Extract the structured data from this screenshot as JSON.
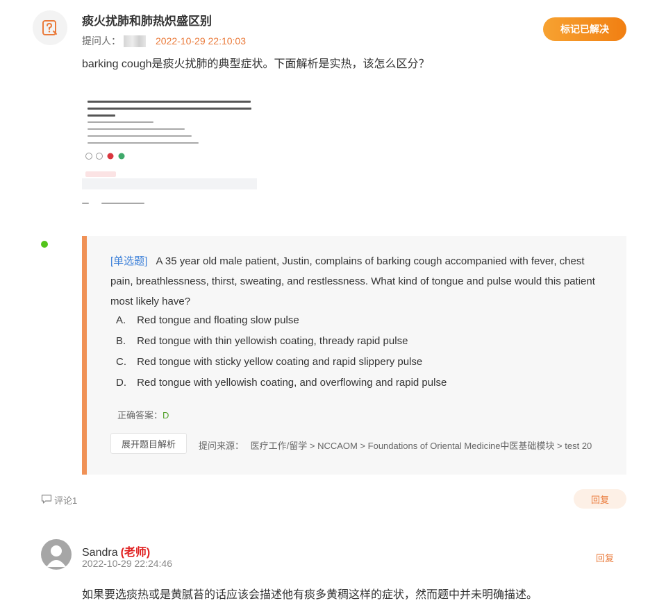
{
  "question": {
    "title": "痰火扰肺和肺热炽盛区别",
    "asker_label": "提问人：",
    "time": "2022-10-29 22:10:03",
    "resolve_button": "标记已解决",
    "text": "barking cough是痰火扰肺的典型症状。下面解析是实热，该怎么区分？"
  },
  "card": {
    "type_label": "[单选题]",
    "stem": "A 35 year old male patient, Justin, complains of barking cough accompanied with fever, chest pain, breathlessness, thirst, sweating, and restlessness. What kind of tongue and pulse would this patient most likely have?",
    "options": [
      {
        "letter": "A.",
        "text": "Red tongue and floating slow pulse"
      },
      {
        "letter": "B.",
        "text": "Red tongue with thin yellowish coating, thready rapid pulse"
      },
      {
        "letter": "C.",
        "text": "Red tongue with sticky yellow coating and rapid slippery pulse"
      },
      {
        "letter": "D.",
        "text": "Red tongue with yellowish coating, and overflowing and rapid pulse"
      }
    ],
    "answer_label": "正确答案：",
    "answer_value": "D",
    "expand_button": "展开题目解析",
    "source_label": "提问来源：",
    "source_path": "医疗工作/留学 > NCCAOM > Foundations of Oriental Medicine中医基础模块 > test 20"
  },
  "comments": {
    "count_label": "评论1",
    "reply_button": "回复"
  },
  "comment": {
    "name": "Sandra",
    "role": "(老师)",
    "time": "2022-10-29 22:24:46",
    "reply": "回复",
    "text": "如果要选痰热或是黄腻苔的话应该会描述他有痰多黄稠这样的症状，然而题中并未明确描述。"
  },
  "colors": {
    "accent": "#f17f12",
    "card_border": "#f09156",
    "link_blue": "#3b7fd8",
    "teacher_red": "#e02020"
  }
}
